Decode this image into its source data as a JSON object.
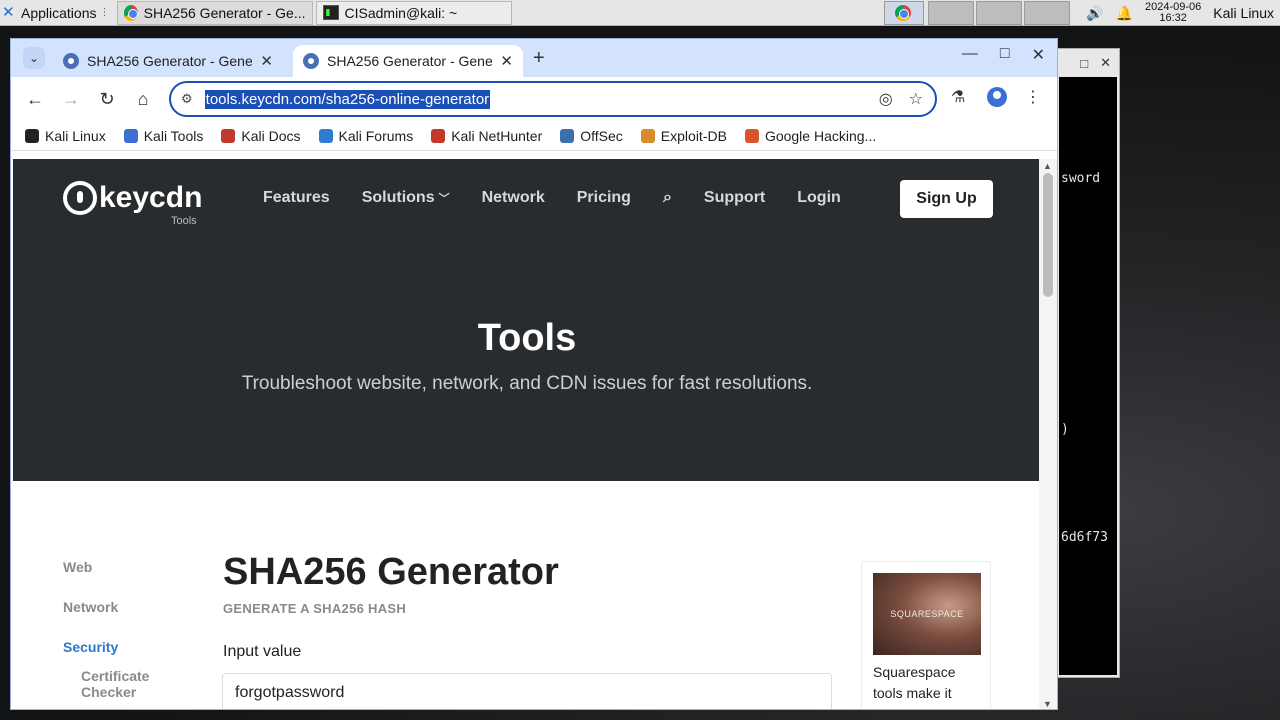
{
  "taskbar": {
    "applications_label": "Applications",
    "window1_title": "SHA256 Generator - Ge...",
    "window2_title": "CISadmin@kali: ~",
    "clock_date": "2024-09-06",
    "clock_time": "16:32",
    "user_label": "Kali Linux"
  },
  "terminal": {
    "lines": [
      "sword",
      ")",
      "6d6f73"
    ]
  },
  "browser": {
    "tabs": [
      {
        "title": "SHA256 Generator - Gene"
      },
      {
        "title": "SHA256 Generator - Gene"
      }
    ],
    "url": "tools.keycdn.com/sha256-online-generator",
    "bookmarks": [
      "Kali Linux",
      "Kali Tools",
      "Kali Docs",
      "Kali Forums",
      "Kali NetHunter",
      "OffSec",
      "Exploit-DB",
      "Google Hacking..."
    ],
    "bookmark_colors": [
      "#222222",
      "#3b6fd6",
      "#c0392b",
      "#2e7bd1",
      "#c0392b",
      "#3a6fb0",
      "#d98a2b",
      "#d9542b"
    ]
  },
  "page": {
    "logo_text": "keycdn",
    "logo_sub": "Tools",
    "nav": [
      "Features",
      "Solutions",
      "Network",
      "Pricing",
      "Support",
      "Login"
    ],
    "signup": "Sign Up",
    "hero_title": "Tools",
    "hero_subtitle": "Troubleshoot website, network, and CDN issues for fast resolutions.",
    "sidebar": [
      "Web",
      "Network",
      "Security",
      "Certificate",
      "Checker"
    ],
    "title": "SHA256 Generator",
    "subtitle": "GENERATE A SHA256 HASH",
    "input_label": "Input value",
    "input_value": "forgotpassword",
    "ad_brand": "SQUARESPACE",
    "ad_text": "Squarespace tools make it"
  }
}
